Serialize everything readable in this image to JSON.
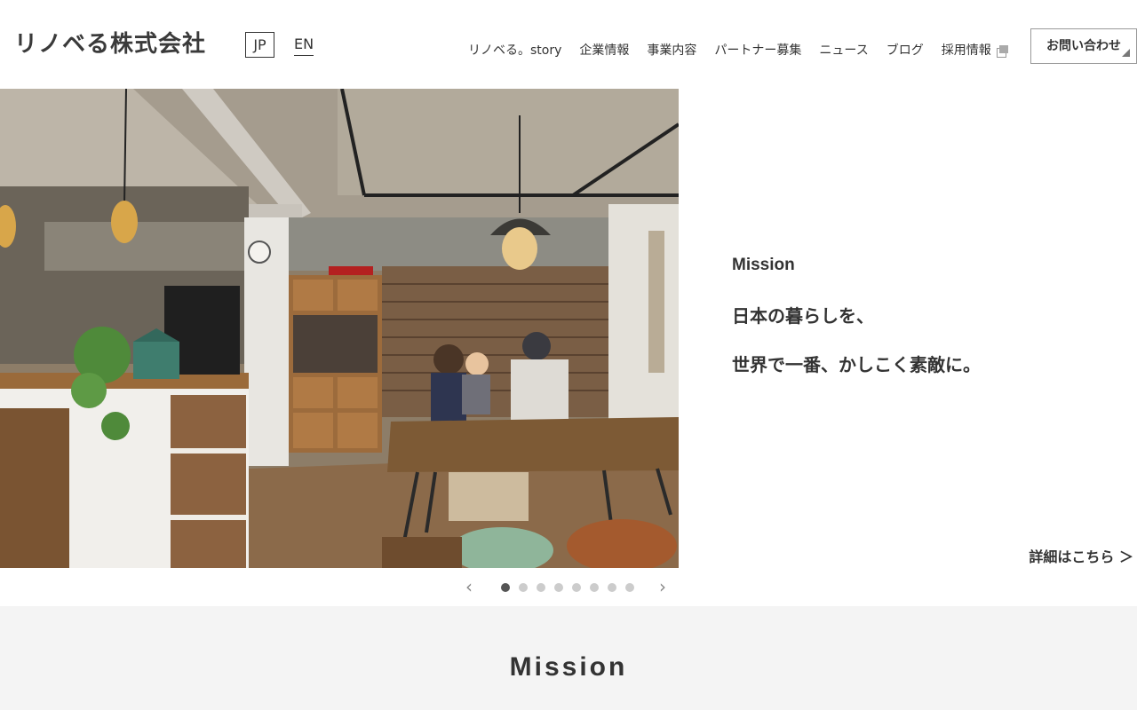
{
  "header": {
    "logo": "リノベる株式会社",
    "lang": {
      "jp": "JP",
      "en": "EN"
    },
    "nav": [
      {
        "label": "リノベる。story"
      },
      {
        "label": "企業情報"
      },
      {
        "label": "事業内容"
      },
      {
        "label": "パートナー募集"
      },
      {
        "label": "ニュース"
      },
      {
        "label": "ブログ"
      },
      {
        "label": "採用情報"
      }
    ],
    "contact_label": "お問い合わせ"
  },
  "hero": {
    "image_icon": "renovated-dining-room-photo",
    "mission_label": "Mission",
    "mission_lines": [
      "日本の暮らしを、",
      "世界で一番、かしこく素敵に。"
    ],
    "detail_link": "詳細はこちら ＞"
  },
  "slider": {
    "prev_icon": "chevron-left-icon",
    "next_icon": "chevron-right-icon",
    "prev_glyph": "‹",
    "next_glyph": "›",
    "slide_count": 8,
    "active_index": 1
  },
  "section": {
    "title": "Mission"
  },
  "colors": {
    "text": "#333333",
    "section_bg": "#f4f4f4",
    "dot_active": "#555555",
    "dot_inactive": "#cccccc"
  }
}
